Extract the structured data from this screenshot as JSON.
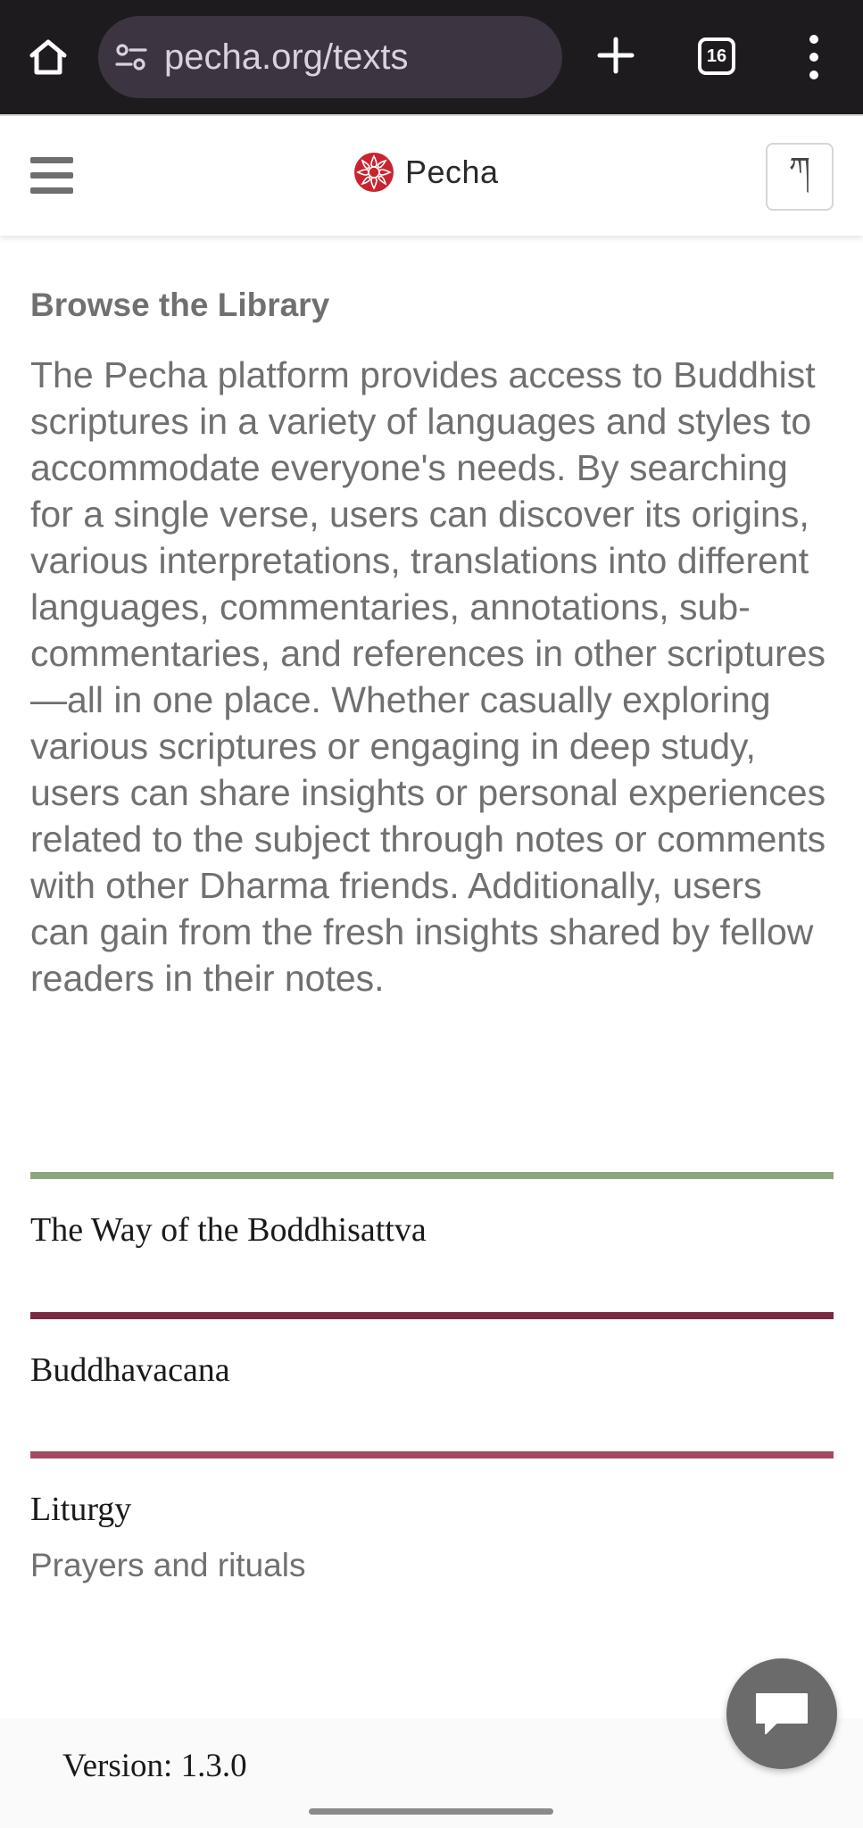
{
  "browser": {
    "url": "pecha.org/texts",
    "tab_count": "16",
    "icons": [
      "home-icon",
      "site-settings-icon",
      "new-tab-icon",
      "tab-switcher-icon",
      "more-options-icon"
    ]
  },
  "header": {
    "brand_name": "Pecha",
    "lang_toggle_label": "ཀ",
    "icons": [
      "menu-icon",
      "pecha-logo-icon"
    ],
    "colors": {
      "logo_red": "#c8242f"
    }
  },
  "main": {
    "section_title": "Browse the Library",
    "intro": "The Pecha platform provides access to Buddhist scriptures in a variety of languages and styles to accommodate everyone's needs. By searching for a single verse, users can discover its origins, various interpretations, translations into different languages, commentaries, annotations, sub-commentaries, and references in other scriptures—all in one place. Whether casually exploring various scriptures or engaging in deep study, users can share insights or personal experiences related to the subject through notes or comments with other Dharma friends. Additionally, users can gain from the fresh insights shared by fellow readers in their notes."
  },
  "categories": [
    {
      "title": "The Way of the Boddhisattva",
      "subtitle": "",
      "color": "#8ea67e"
    },
    {
      "title": "Buddhavacana",
      "subtitle": "",
      "color": "#7a2a3e"
    },
    {
      "title": "Liturgy",
      "subtitle": "Prayers and rituals",
      "color": "#a24a62"
    }
  ],
  "footer": {
    "version": "Version: 1.3.0",
    "chat_icon": "chat-bubble-icon"
  }
}
